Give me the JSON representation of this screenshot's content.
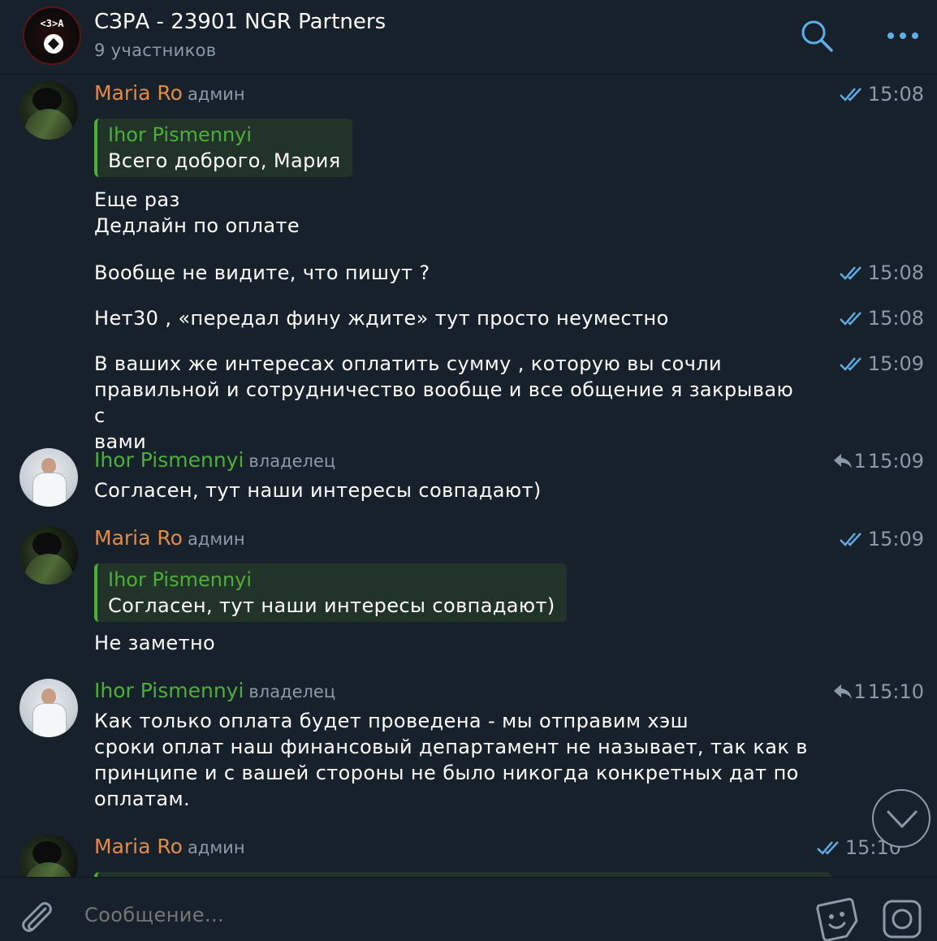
{
  "header": {
    "title": "СЗРА - 23901 NGR Partners",
    "subtitle": "9 участников",
    "avatar_text": "<3>A"
  },
  "messages": [
    {
      "sender": "Maria Ro",
      "role": "админ",
      "time": "15:08",
      "status": "read",
      "quote": {
        "name": "Ihor Pismennyi",
        "text": "Всего доброго, Мария"
      },
      "lines": [
        "Еще раз",
        "Дедлайн по оплате",
        ""
      ]
    },
    {
      "lines": [
        "Вообще не видите, что пишут ?"
      ],
      "time": "15:08",
      "status": "read"
    },
    {
      "lines": [
        "Нет30 , «передал фину ждите» тут просто неуместно"
      ],
      "time": "15:08",
      "status": "read"
    },
    {
      "lines": [
        "В ваших же интересах оплатить сумму , которую вы сочли",
        "правильной и сотрудничество вообще и все общение я закрываю с",
        "вами"
      ],
      "time": "15:09",
      "status": "read"
    },
    {
      "sender": "Ihor Pismennyi",
      "role": "владелец",
      "time": "15:09",
      "reply_count": "1",
      "lines": [
        "Согласен, тут наши интересы совпадают)"
      ]
    },
    {
      "sender": "Maria Ro",
      "role": "админ",
      "time": "15:09",
      "status": "read",
      "quote": {
        "name": "Ihor Pismennyi",
        "text": "Согласен, тут наши интересы совпадают)"
      },
      "lines": [
        "Не заметно"
      ]
    },
    {
      "sender": "Ihor Pismennyi",
      "role": "владелец",
      "time": "15:10",
      "reply_count": "1",
      "lines": [
        "Как только оплата будет проведена - мы отправим хэш",
        "сроки оплат наш финансовый департамент не называет, так как в",
        "принципе и с вашей стороны не было никогда конкретных дат по",
        "оплатам."
      ]
    },
    {
      "sender": "Maria Ro",
      "role": "админ",
      "time": "15:10",
      "status": "read"
    }
  ],
  "composer": {
    "placeholder": "Сообщение..."
  },
  "colors": {
    "background": "#17212b",
    "maria_name": "#e38b43",
    "ihor_name": "#4cb036",
    "muted": "#8b9aa9",
    "check": "#5eaee8"
  },
  "icons": [
    "search-icon",
    "more-icon",
    "check-double-icon",
    "reply-icon",
    "chevron-down-icon",
    "attach-icon",
    "sticker-icon",
    "camera-icon"
  ]
}
